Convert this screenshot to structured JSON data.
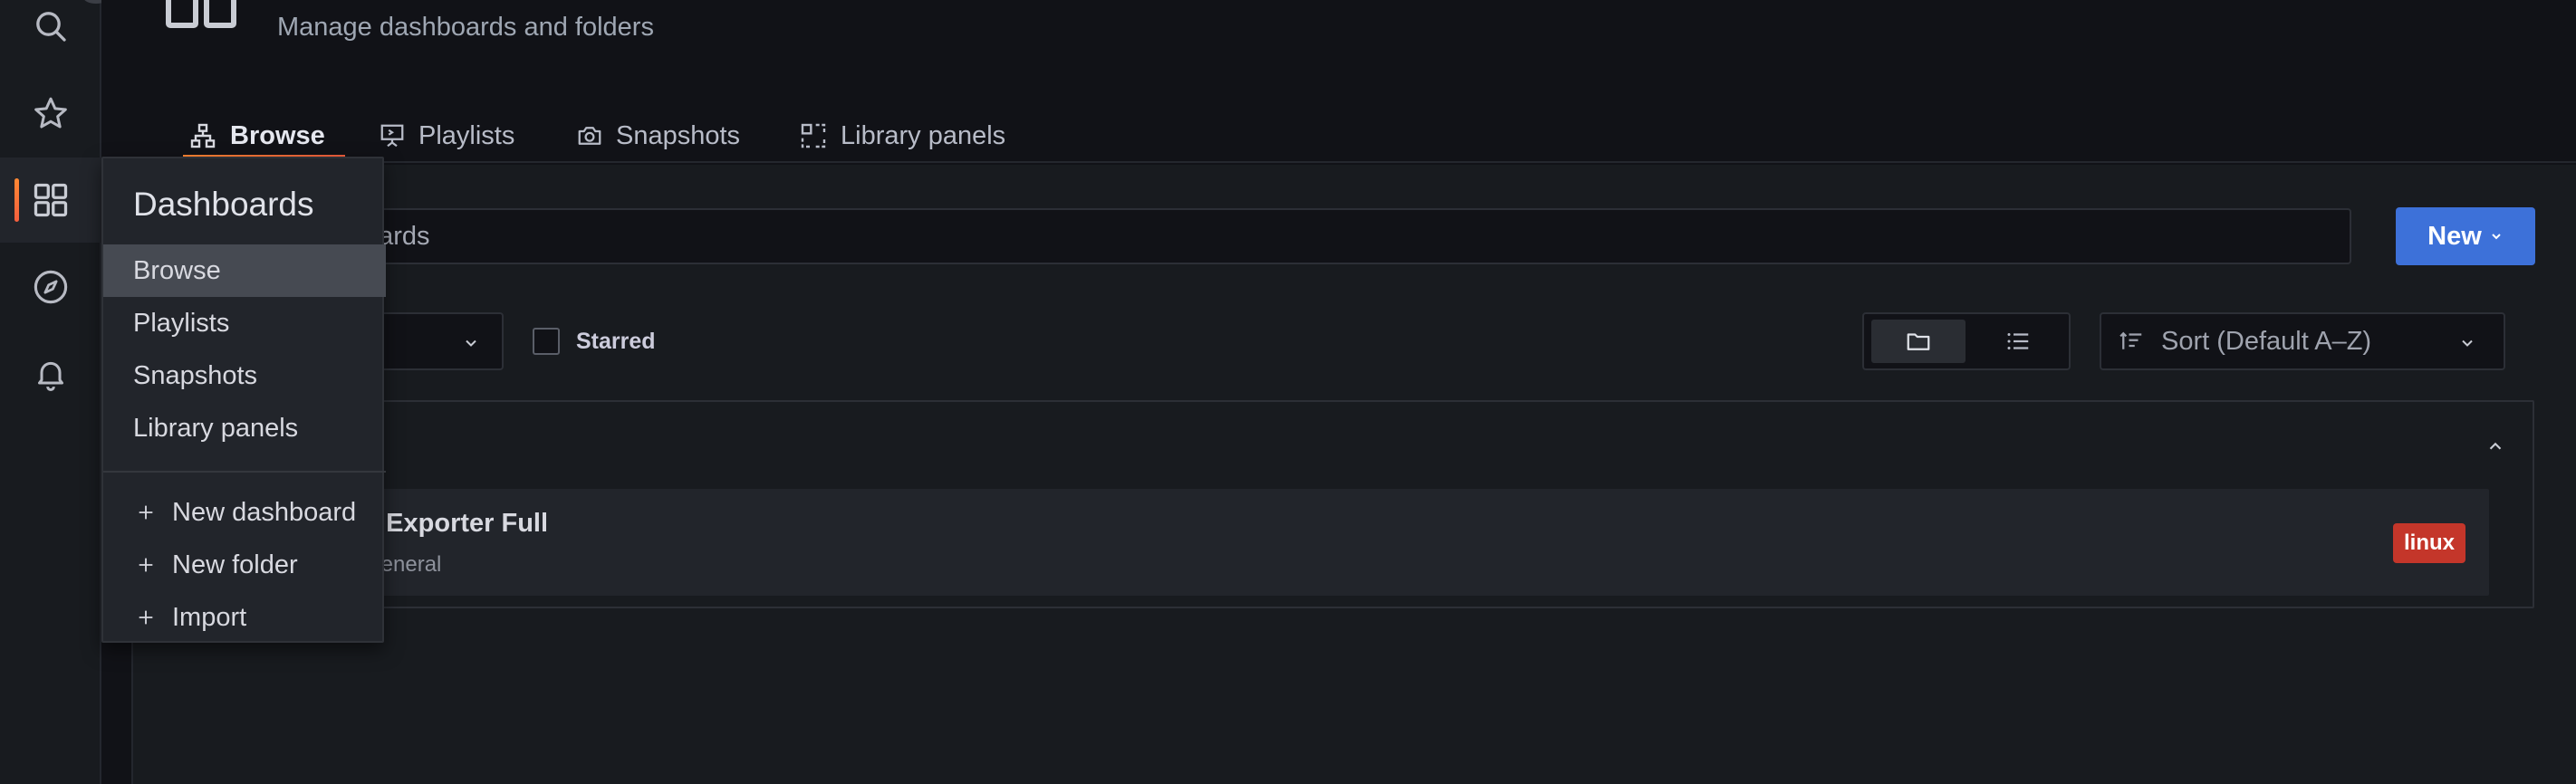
{
  "header": {
    "subtitle": "Manage dashboards and folders",
    "tabs": [
      {
        "label": "Browse",
        "icon": "sitemap-icon"
      },
      {
        "label": "Playlists",
        "icon": "presentation-icon"
      },
      {
        "label": "Snapshots",
        "icon": "camera-icon"
      },
      {
        "label": "Library panels",
        "icon": "library-panels-icon"
      }
    ]
  },
  "sidebar": {
    "items": [
      {
        "name": "search",
        "icon": "search-icon"
      },
      {
        "name": "starred",
        "icon": "star-icon"
      },
      {
        "name": "dashboards",
        "icon": "apps-icon",
        "active": true
      },
      {
        "name": "explore",
        "icon": "compass-icon"
      },
      {
        "name": "alerting",
        "icon": "bell-icon"
      }
    ]
  },
  "search": {
    "visible_text": "oards"
  },
  "toolbar": {
    "new_label": "New",
    "starred_label": "Starred",
    "sort_label": "Sort (Default A–Z)"
  },
  "results": {
    "dashboard_title": "e Exporter Full",
    "dashboard_folder": "General",
    "tag": "linux"
  },
  "menu": {
    "title": "Dashboards",
    "items": [
      "Browse",
      "Playlists",
      "Snapshots",
      "Library panels"
    ],
    "actions": [
      "New dashboard",
      "New folder",
      "Import"
    ]
  },
  "colors": {
    "accent": "#ff8833",
    "primary": "#3d71d9",
    "tag": "#c4362a"
  }
}
